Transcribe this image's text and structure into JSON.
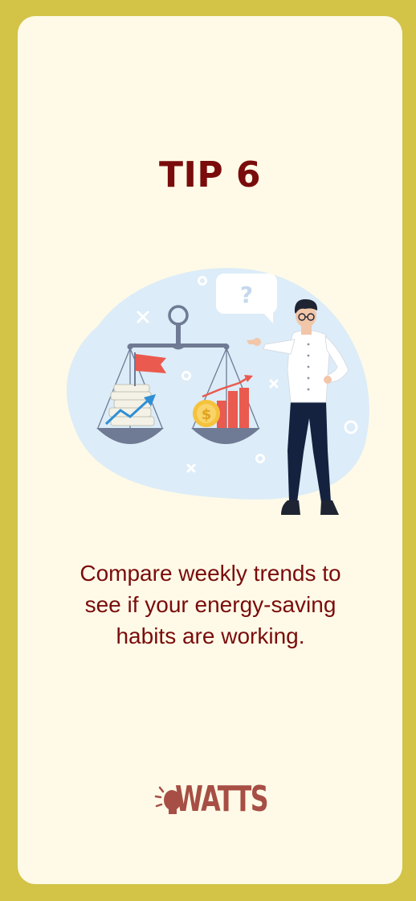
{
  "tip": {
    "title": "TIP 6",
    "text": "Compare weekly trends to see if your energy-saving habits are working.",
    "illustration": "person-balance-scale-comparison-illustration"
  },
  "brand": {
    "name": "WATTS",
    "icon": "lightbulb-icon"
  },
  "colors": {
    "outer_background": "#d3c347",
    "card_background": "#fefae7",
    "title": "#7a0c0c",
    "text": "#7a0c0c",
    "brand": "#a74e45",
    "blob": "#dcecf8"
  }
}
